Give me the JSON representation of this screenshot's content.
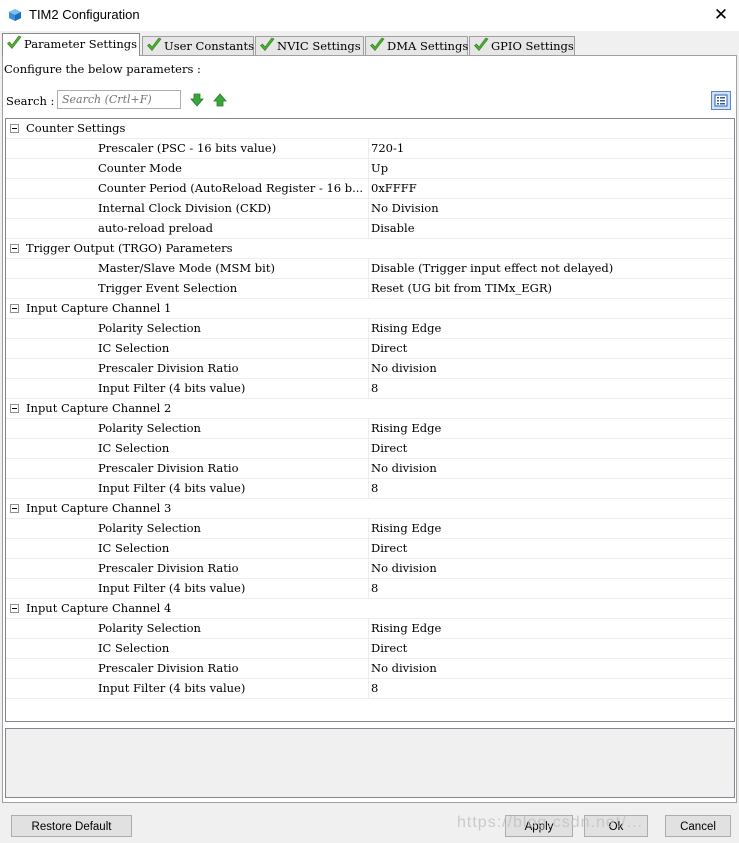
{
  "window": {
    "title": "TIM2 Configuration",
    "close_icon": "✕"
  },
  "tabs": [
    {
      "label": "Parameter Settings",
      "active": true
    },
    {
      "label": "User Constants",
      "active": false
    },
    {
      "label": "NVIC Settings",
      "active": false
    },
    {
      "label": "DMA Settings",
      "active": false
    },
    {
      "label": "GPIO Settings",
      "active": false
    }
  ],
  "header": {
    "configure_text": "Configure the below parameters :",
    "search_label": "Search :",
    "search_placeholder": "Search (Crtl+F)"
  },
  "groups": [
    {
      "title": "Counter Settings",
      "params": [
        {
          "name": "Prescaler (PSC - 16 bits value)",
          "value": "720-1"
        },
        {
          "name": "Counter Mode",
          "value": "Up"
        },
        {
          "name": "Counter Period (AutoReload Register - 16 b...",
          "value": "0xFFFF"
        },
        {
          "name": "Internal Clock Division (CKD)",
          "value": "No Division"
        },
        {
          "name": "auto-reload preload",
          "value": "Disable"
        }
      ]
    },
    {
      "title": "Trigger Output (TRGO) Parameters",
      "params": [
        {
          "name": "Master/Slave Mode (MSM bit)",
          "value": "Disable (Trigger input effect not delayed)"
        },
        {
          "name": "Trigger Event Selection",
          "value": "Reset (UG bit from TIMx_EGR)"
        }
      ]
    },
    {
      "title": "Input Capture Channel 1",
      "params": [
        {
          "name": "Polarity Selection",
          "value": "Rising Edge"
        },
        {
          "name": "IC Selection",
          "value": "Direct"
        },
        {
          "name": "Prescaler Division Ratio",
          "value": "No division"
        },
        {
          "name": "Input Filter (4 bits value)",
          "value": "8"
        }
      ]
    },
    {
      "title": "Input Capture Channel 2",
      "params": [
        {
          "name": "Polarity Selection",
          "value": "Rising Edge"
        },
        {
          "name": "IC Selection",
          "value": "Direct"
        },
        {
          "name": "Prescaler Division Ratio",
          "value": "No division"
        },
        {
          "name": "Input Filter (4 bits value)",
          "value": "8"
        }
      ]
    },
    {
      "title": "Input Capture Channel 3",
      "params": [
        {
          "name": "Polarity Selection",
          "value": "Rising Edge"
        },
        {
          "name": "IC Selection",
          "value": "Direct"
        },
        {
          "name": "Prescaler Division Ratio",
          "value": "No division"
        },
        {
          "name": "Input Filter (4 bits value)",
          "value": "8"
        }
      ]
    },
    {
      "title": "Input Capture Channel 4",
      "params": [
        {
          "name": "Polarity Selection",
          "value": "Rising Edge"
        },
        {
          "name": "IC Selection",
          "value": "Direct"
        },
        {
          "name": "Prescaler Division Ratio",
          "value": "No division"
        },
        {
          "name": "Input Filter (4 bits value)",
          "value": "8"
        }
      ]
    }
  ],
  "buttons": {
    "restore_default": "Restore Default",
    "apply": "Apply",
    "ok": "Ok",
    "cancel": "Cancel"
  },
  "watermark": "https://blog.csdn.net/...",
  "colors": {
    "check_green": "#4caf30",
    "arrow_green": "#3aa63a",
    "view_btn": "#cfe0f7"
  },
  "icons": {
    "app": "cube-icon",
    "tab_check": "checkmark-icon",
    "down": "green-down-arrow-icon",
    "up": "green-up-arrow-icon",
    "view": "list-view-icon"
  }
}
